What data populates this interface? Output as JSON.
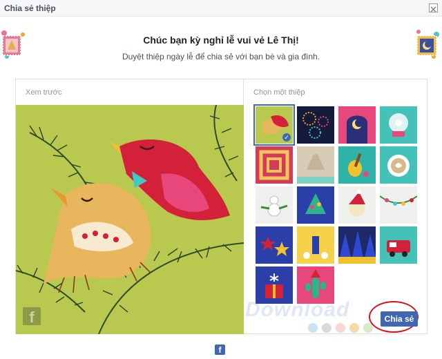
{
  "dialog": {
    "title": "Chia sẻ thiệp",
    "heading": "Chúc bạn kỳ nghỉ lễ vui vẻ Lê Thị!",
    "subheading": "Duyệt thiệp ngày lễ để chia sẻ với bạn bè và gia đình.",
    "close_icon": "close-icon"
  },
  "preview": {
    "label": "Xem trước",
    "image": "red-and-yellow-paper-birds-on-pine-branches",
    "brand_icon": "f"
  },
  "chooser": {
    "label": "Chọn một thiệp",
    "cards": [
      {
        "id": "birds",
        "selected": true
      },
      {
        "id": "fireworks",
        "selected": false
      },
      {
        "id": "moon-window",
        "selected": false
      },
      {
        "id": "snow-globe",
        "selected": false
      },
      {
        "id": "woven-pattern",
        "selected": false
      },
      {
        "id": "sand-angel",
        "selected": false
      },
      {
        "id": "guitar",
        "selected": false
      },
      {
        "id": "latte",
        "selected": false
      },
      {
        "id": "snowman",
        "selected": false
      },
      {
        "id": "cake-tree",
        "selected": false
      },
      {
        "id": "santa-hat-face",
        "selected": false
      },
      {
        "id": "string-lights",
        "selected": false
      },
      {
        "id": "paper-stars",
        "selected": false
      },
      {
        "id": "gift-box",
        "selected": false
      },
      {
        "id": "blue-forest",
        "selected": false
      },
      {
        "id": "red-van",
        "selected": false
      },
      {
        "id": "present-sparkler",
        "selected": false
      },
      {
        "id": "cactus",
        "selected": false
      }
    ]
  },
  "actions": {
    "share_label": "Chia sẻ"
  },
  "footer": {
    "fb_icon": "f"
  },
  "watermark": {
    "text": "Download",
    "dot_colors": [
      "#c9e3f5",
      "#d9d9d9",
      "#f8d7d7",
      "#f5d9a8",
      "#d6e9c8",
      "#c7d9ee"
    ]
  }
}
